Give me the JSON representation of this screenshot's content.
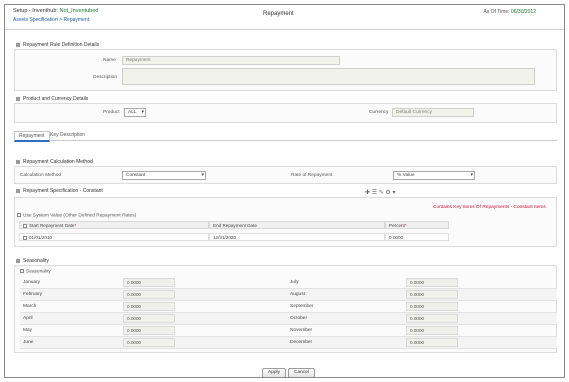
{
  "header": {
    "title_prefix": "Setup - Inventhub: ",
    "title_link": "Not_Inventubed",
    "breadcrumb": "Assets Specification > Repayment",
    "page_title": "Repayment",
    "right_prefix": "As Of Time: ",
    "right_value": "06/30/2012"
  },
  "repayment_section": {
    "title": "Repayment Rule Definition Details",
    "name_label": "Name",
    "name_value": "Repayment",
    "description_label": "Description",
    "description_value": ""
  },
  "product_section": {
    "title": "Product and Currency Details",
    "product_label": "Product",
    "product_value": "ALL",
    "currency_label": "Currency",
    "currency_value": "Default Currency"
  },
  "tabs": [
    "Repayment",
    "Key Description"
  ],
  "calc_section": {
    "title": "Repayment Calculation Method",
    "method_label": "Calculation Method",
    "method_value": "Constant",
    "rate_label": "Rate of Repayment",
    "rate_value": "% Value"
  },
  "spec_section": {
    "title": "Repayment Specification - Constant",
    "toolbar_icons": "✚ ☰   ✎ ⚙ ▾",
    "warning_link": "Contains Key Items Of Repayments - Constant Items",
    "table_title": "Use System Value (Other Defined Repayment Rates)",
    "columns": [
      "Start Repayment Date",
      "End Repayment Date",
      "Percent"
    ],
    "rows": [
      {
        "start": "01/01/2010",
        "end": "12/31/2020",
        "percent": "0.0000"
      }
    ]
  },
  "seasonality": {
    "title": "Seasonality",
    "checkbox_label": "Seasonality",
    "months_left": [
      {
        "name": "January",
        "value": "0.0000"
      },
      {
        "name": "February",
        "value": "0.0000"
      },
      {
        "name": "March",
        "value": "0.0000"
      },
      {
        "name": "April",
        "value": "0.0000"
      },
      {
        "name": "May",
        "value": "0.0000"
      },
      {
        "name": "June",
        "value": "0.0000"
      }
    ],
    "months_right": [
      {
        "name": "July",
        "value": "0.0000"
      },
      {
        "name": "August",
        "value": "0.0000"
      },
      {
        "name": "September",
        "value": "0.0000"
      },
      {
        "name": "October",
        "value": "0.0000"
      },
      {
        "name": "November",
        "value": "0.0000"
      },
      {
        "name": "December",
        "value": "0.0000"
      }
    ]
  },
  "footer": {
    "apply_label": "Apply",
    "cancel_label": "Cancel"
  },
  "colors": {
    "accent": "#2f6fbf",
    "link_green": "#1d7a2e",
    "warning_red": "#c8102e"
  }
}
